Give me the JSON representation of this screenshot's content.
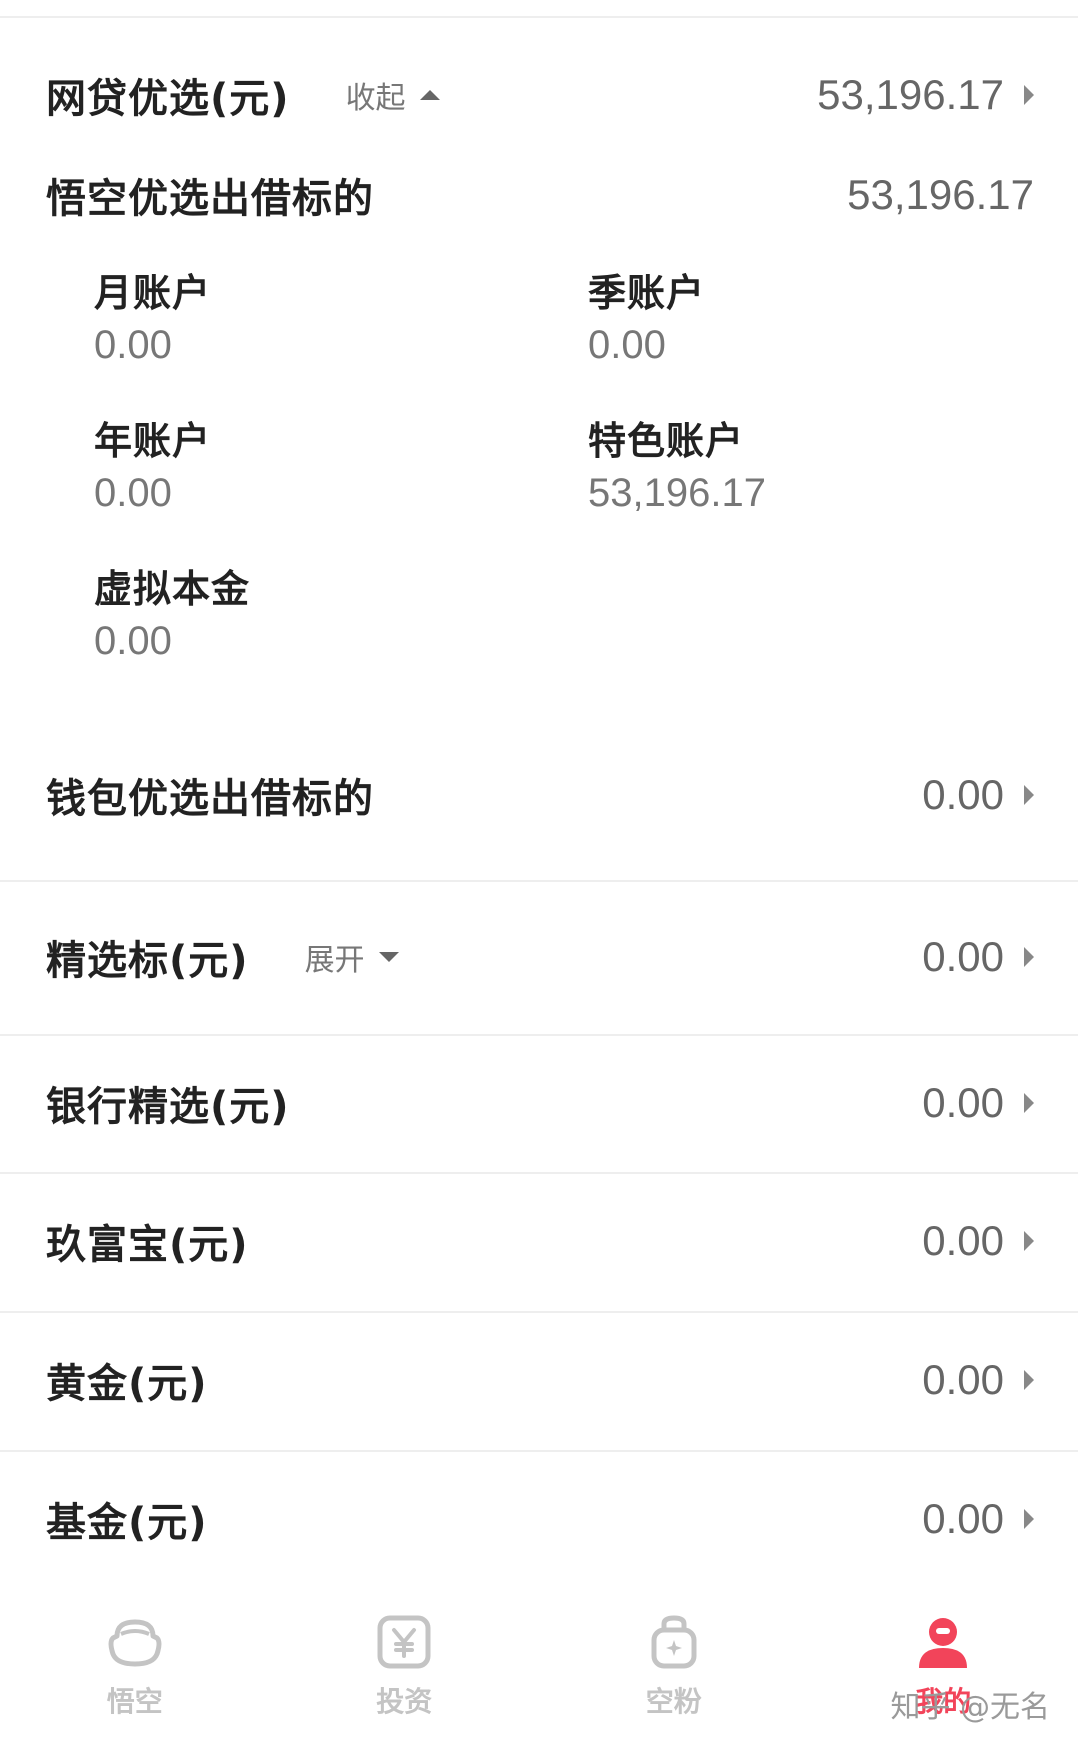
{
  "sections": {
    "wangdai": {
      "title": "网贷优选(元)",
      "toggle": "收起",
      "value": "53,196.17",
      "sub_title": "悟空优选出借标的",
      "sub_value": "53,196.17",
      "accounts": [
        {
          "label": "月账户",
          "value": "0.00"
        },
        {
          "label": "季账户",
          "value": "0.00"
        },
        {
          "label": "年账户",
          "value": "0.00"
        },
        {
          "label": "特色账户",
          "value": "53,196.17"
        },
        {
          "label": "虚拟本金",
          "value": "0.00"
        }
      ],
      "wallet_title": "钱包优选出借标的",
      "wallet_value": "0.00"
    },
    "jingxuan": {
      "title": "精选标(元)",
      "toggle": "展开",
      "value": "0.00"
    },
    "bank": {
      "title": "银行精选(元)",
      "value": "0.00"
    },
    "jiufubao": {
      "title": "玖富宝(元)",
      "value": "0.00"
    },
    "gold": {
      "title": "黄金(元)",
      "value": "0.00"
    },
    "fund": {
      "title": "基金(元)",
      "value": "0.00"
    }
  },
  "tabbar": {
    "items": [
      {
        "label": "悟空",
        "icon": "wukong-icon"
      },
      {
        "label": "投资",
        "icon": "yen-icon"
      },
      {
        "label": "空粉",
        "icon": "bag-icon"
      },
      {
        "label": "我的",
        "icon": "user-icon",
        "active": true
      }
    ],
    "active_color": "#f2445a",
    "inactive_color": "#c4c4c4"
  },
  "watermark": "知乎 @无名"
}
